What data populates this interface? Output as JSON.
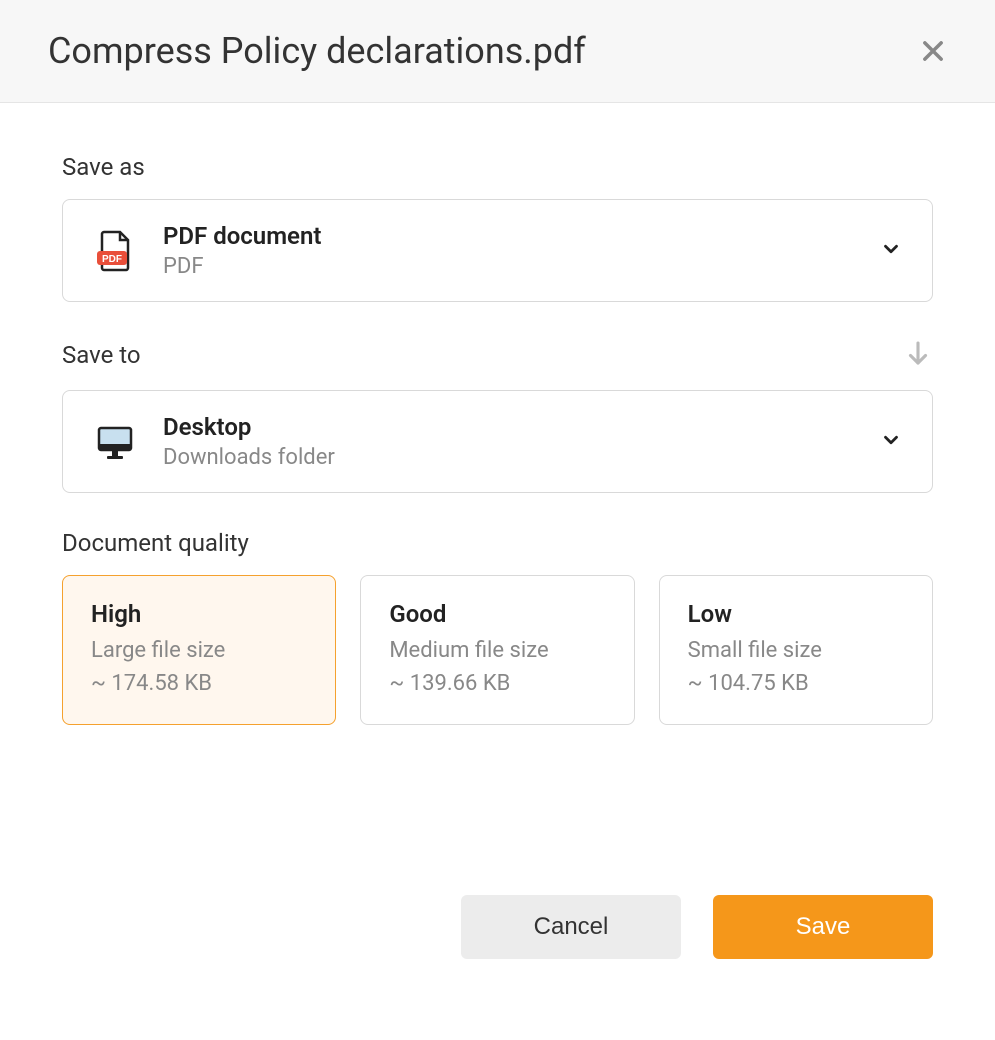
{
  "header": {
    "title": "Compress Policy declarations.pdf"
  },
  "saveAs": {
    "label": "Save as",
    "option": {
      "title": "PDF document",
      "subtitle": "PDF"
    }
  },
  "saveTo": {
    "label": "Save to",
    "option": {
      "title": "Desktop",
      "subtitle": "Downloads folder"
    }
  },
  "quality": {
    "label": "Document quality",
    "options": [
      {
        "title": "High",
        "desc": "Large file size",
        "size": "~ 174.58 KB",
        "selected": true
      },
      {
        "title": "Good",
        "desc": "Medium file size",
        "size": "~ 139.66 KB",
        "selected": false
      },
      {
        "title": "Low",
        "desc": "Small file size",
        "size": "~ 104.75 KB",
        "selected": false
      }
    ]
  },
  "footer": {
    "cancel": "Cancel",
    "save": "Save"
  }
}
